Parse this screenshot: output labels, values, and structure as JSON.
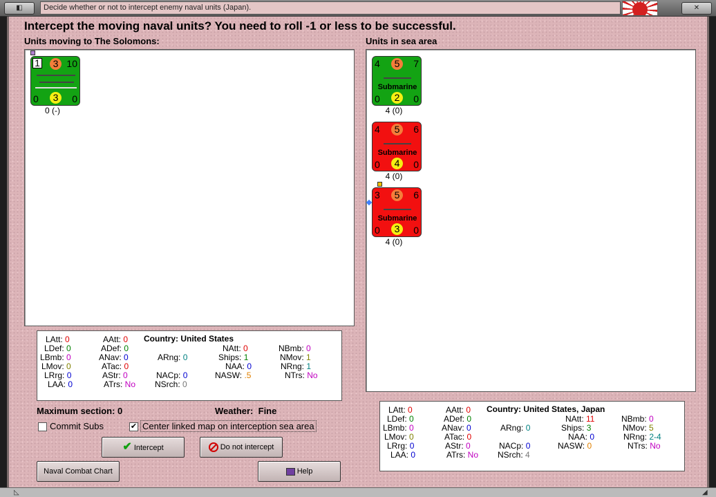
{
  "window": {
    "title": "Decide whether or not to intercept enemy naval units (Japan)."
  },
  "prompt": "Intercept the moving naval units?  You need to roll -1 or less to be successful.",
  "left_panel": {
    "label": "Units moving to The Solomons:",
    "units": [
      {
        "top_left": "1",
        "top_mid": "3",
        "top_right": "10",
        "bot_left": "0",
        "bot_mid": "3",
        "bot_right": "0",
        "caption": "0 (-)"
      }
    ]
  },
  "right_panel": {
    "label": "Units in sea area",
    "units": [
      {
        "top_left": "4",
        "top_mid": "5",
        "top_right": "7",
        "name": "Submarine",
        "bot_left": "0",
        "bot_mid": "2",
        "bot_right": "0",
        "caption": "4 (0)",
        "color": "#13a313"
      },
      {
        "top_left": "4",
        "top_mid": "5",
        "top_right": "6",
        "name": "Submarine",
        "bot_left": "0",
        "bot_mid": "4",
        "bot_right": "0",
        "caption": "4 (0)",
        "color": "#f21010"
      },
      {
        "top_left": "3",
        "top_mid": "5",
        "top_right": "6",
        "name": "Submarine",
        "bot_left": "0",
        "bot_mid": "3",
        "bot_right": "0",
        "caption": "4 (0)",
        "color": "#f21010"
      }
    ]
  },
  "stats_left": {
    "country_label": "Country:",
    "country": "United States",
    "LAtt": "0",
    "LDef": "0",
    "LBmb": "0",
    "LMov": "0",
    "LRrg": "0",
    "LAA": "0",
    "AAtt": "0",
    "ADef": "0",
    "ANav": "0",
    "ATac": "0",
    "AStr": "0",
    "ATrs": "No",
    "ARng": "0",
    "NACp": "0",
    "NSrch": "0",
    "NAtt": "0",
    "Ships": "1",
    "NAA": "0",
    "NASW": ".5",
    "NBmb": "0",
    "NMov": "1",
    "NRng": "1",
    "NTrs": "No"
  },
  "stats_right": {
    "country_label": "Country:",
    "country": "United States, Japan",
    "LAtt": "0",
    "LDef": "0",
    "LBmb": "0",
    "LMov": "0",
    "LRrg": "0",
    "LAA": "0",
    "AAtt": "0",
    "ADef": "0",
    "ANav": "0",
    "ATac": "0",
    "AStr": "0",
    "ATrs": "No",
    "ARng": "0",
    "NACp": "0",
    "NSrch": "4",
    "NAtt": "11",
    "Ships": "3",
    "NAA": "0",
    "NASW": "0",
    "NBmb": "0",
    "NMov": "5",
    "NRng": "2-4",
    "NTrs": "No"
  },
  "info": {
    "max_section": "Maximum section: 0",
    "weather_label": "Weather:",
    "weather": "Fine"
  },
  "options": {
    "commit_subs": "Commit Subs",
    "center_map": "Center linked map on interception sea area"
  },
  "buttons": {
    "intercept": "Intercept",
    "do_not": "Do not intercept",
    "chart": "Naval Combat Chart",
    "help": "Help"
  },
  "colors": {
    "background": "#dcb4b8",
    "green_counter": "#13a313",
    "red_counter": "#f21010",
    "orange_circle": "#f47d3a",
    "yellow_circle": "#f5ef12"
  }
}
